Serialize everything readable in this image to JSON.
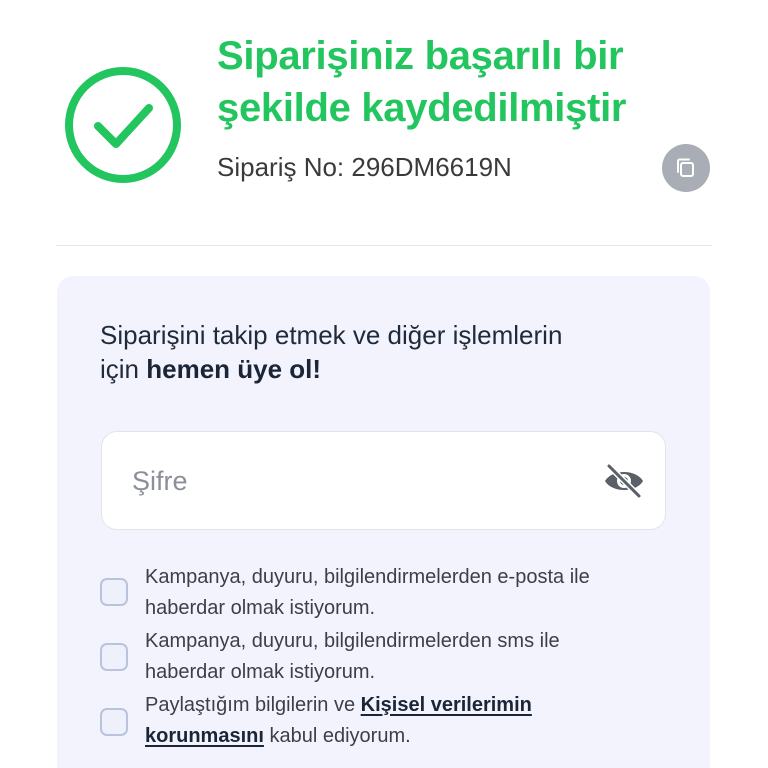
{
  "success": {
    "icon": "check-circle-icon",
    "title_line1": "Siparişiniz başarılı bir",
    "title_line2": "şekilde kaydedilmiştir",
    "order_no": "Sipariş No: 296DM6619N",
    "copy_icon": "copy-icon"
  },
  "signup": {
    "prompt_prefix_line1": "Siparişini takip etmek ve diğer işlemlerin",
    "prompt_prefix_line2": "için ",
    "prompt_strong": "hemen üye ol!",
    "password": {
      "placeholder": "Şifre",
      "value": "",
      "toggle_icon": "eye-off-icon"
    },
    "consents": [
      {
        "text_line1": "Kampanya, duyuru, bilgilendirmelerden e-posta ile",
        "text_line2": "haberdar olmak istiyorum.",
        "checked": false
      },
      {
        "text_line1": "Kampanya, duyuru, bilgilendirmelerden sms ile",
        "text_line2": "haberdar olmak istiyorum.",
        "checked": false
      },
      {
        "text_before": "Paylaştığım bilgilerin ve ",
        "link_text_line1": "Kişisel verilerimin",
        "link_text_line2": "korunmasını",
        "text_after": " kabul ediyorum.",
        "checked": false
      }
    ]
  },
  "colors": {
    "success": "#22c55e",
    "card_bg": "#f3f3fd",
    "copy_btn_bg": "#a9adb6",
    "text_dark": "#1b2536"
  }
}
